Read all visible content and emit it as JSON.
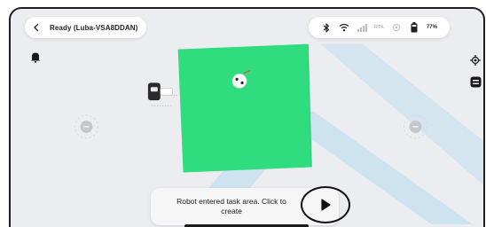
{
  "status": {
    "text": "Ready  (Luba-VSA8DDAN)"
  },
  "status_icons": {
    "bluetooth": "bluetooth-icon",
    "wifi": "wifi-icon",
    "cellular": "cellular-signal-icon",
    "rtk_label": "RTK",
    "battery_level": "77%"
  },
  "toast": {
    "message": "Robot entered task area. Click to\ncreate"
  },
  "colors": {
    "map_background": "#ecedf0",
    "task_area": "#2fdc7e",
    "watermark": "#b9d9ee",
    "toast_bg": "#f6f6f7"
  },
  "icons": {
    "back": "chevron-left-icon",
    "alert": "bell-icon",
    "locate": "locate-icon",
    "map_layers": "map-layers-icon",
    "charging_station": "charging-station-icon",
    "robot": "robot-mower-icon",
    "play": "play-icon"
  }
}
